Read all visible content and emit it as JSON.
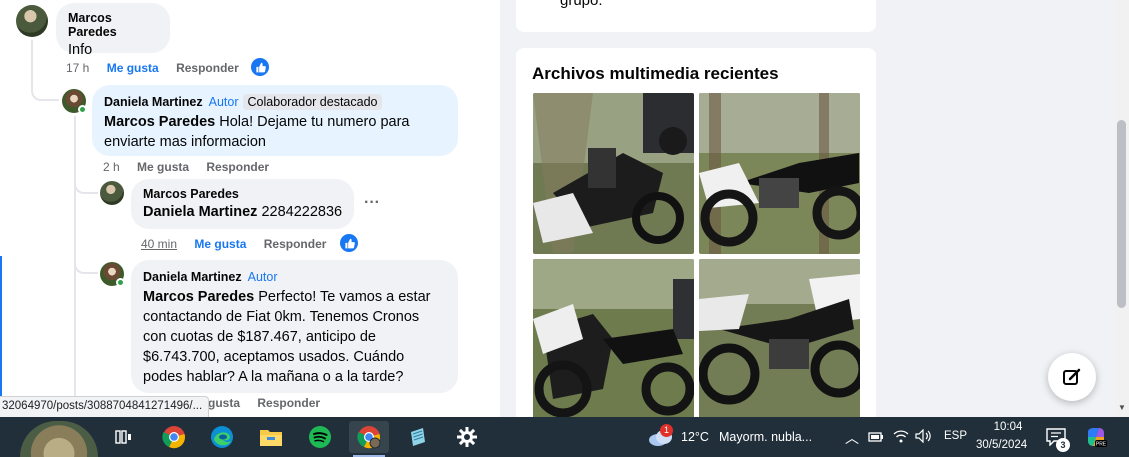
{
  "comments": {
    "c1": {
      "author": "Marcos Paredes",
      "text": "Info",
      "time": "17 h",
      "like": "Me gusta",
      "reply": "Responder"
    },
    "c2": {
      "author": "Daniela Martinez",
      "badge_author": "Autor",
      "badge_top": "Colaborador destacado",
      "mention": "Marcos Paredes",
      "text": "Hola! Dejame tu numero para enviarte mas informacion",
      "time": "2 h",
      "like": "Me gusta",
      "reply": "Responder"
    },
    "c3": {
      "author": "Marcos Paredes",
      "mention": "Daniela Martinez",
      "text": "2284222836",
      "time": "40 min",
      "like": "Me gusta",
      "reply": "Responder",
      "more": "···"
    },
    "c4": {
      "author": "Daniela Martinez",
      "badge_author": "Autor",
      "mention": "Marcos Paredes",
      "text": "Perfecto! Te vamos a estar contactando de Fiat 0km. Tenemos Cronos con cuotas de $187.467, anticipo de $6.743.700, aceptamos usados. Cuándo podes hablar? A la mañana o a la tarde?",
      "like": "Me gusta",
      "reply": "Responder"
    }
  },
  "status_url": "32064970/posts/3088704841271496/...",
  "right": {
    "top_card_text": "grupo.",
    "media_title": "Archivos multimedia recientes"
  },
  "colors": {
    "accent": "#1877f2",
    "highlight": "#e7f3ff",
    "taskbar": "#202f3a"
  },
  "taskbar": {
    "apps": [
      "task-view-icon",
      "chrome-icon",
      "edge-icon",
      "file-explorer-icon",
      "spotify-icon",
      "chrome-profile-icon",
      "notepad-icon",
      "settings-icon"
    ],
    "weather_temp": "12°C",
    "weather_text": "Mayorm. nubla...",
    "language": "ESP",
    "time": "10:04",
    "date": "30/5/2024",
    "notifications": "3",
    "weather_badge": "1"
  }
}
